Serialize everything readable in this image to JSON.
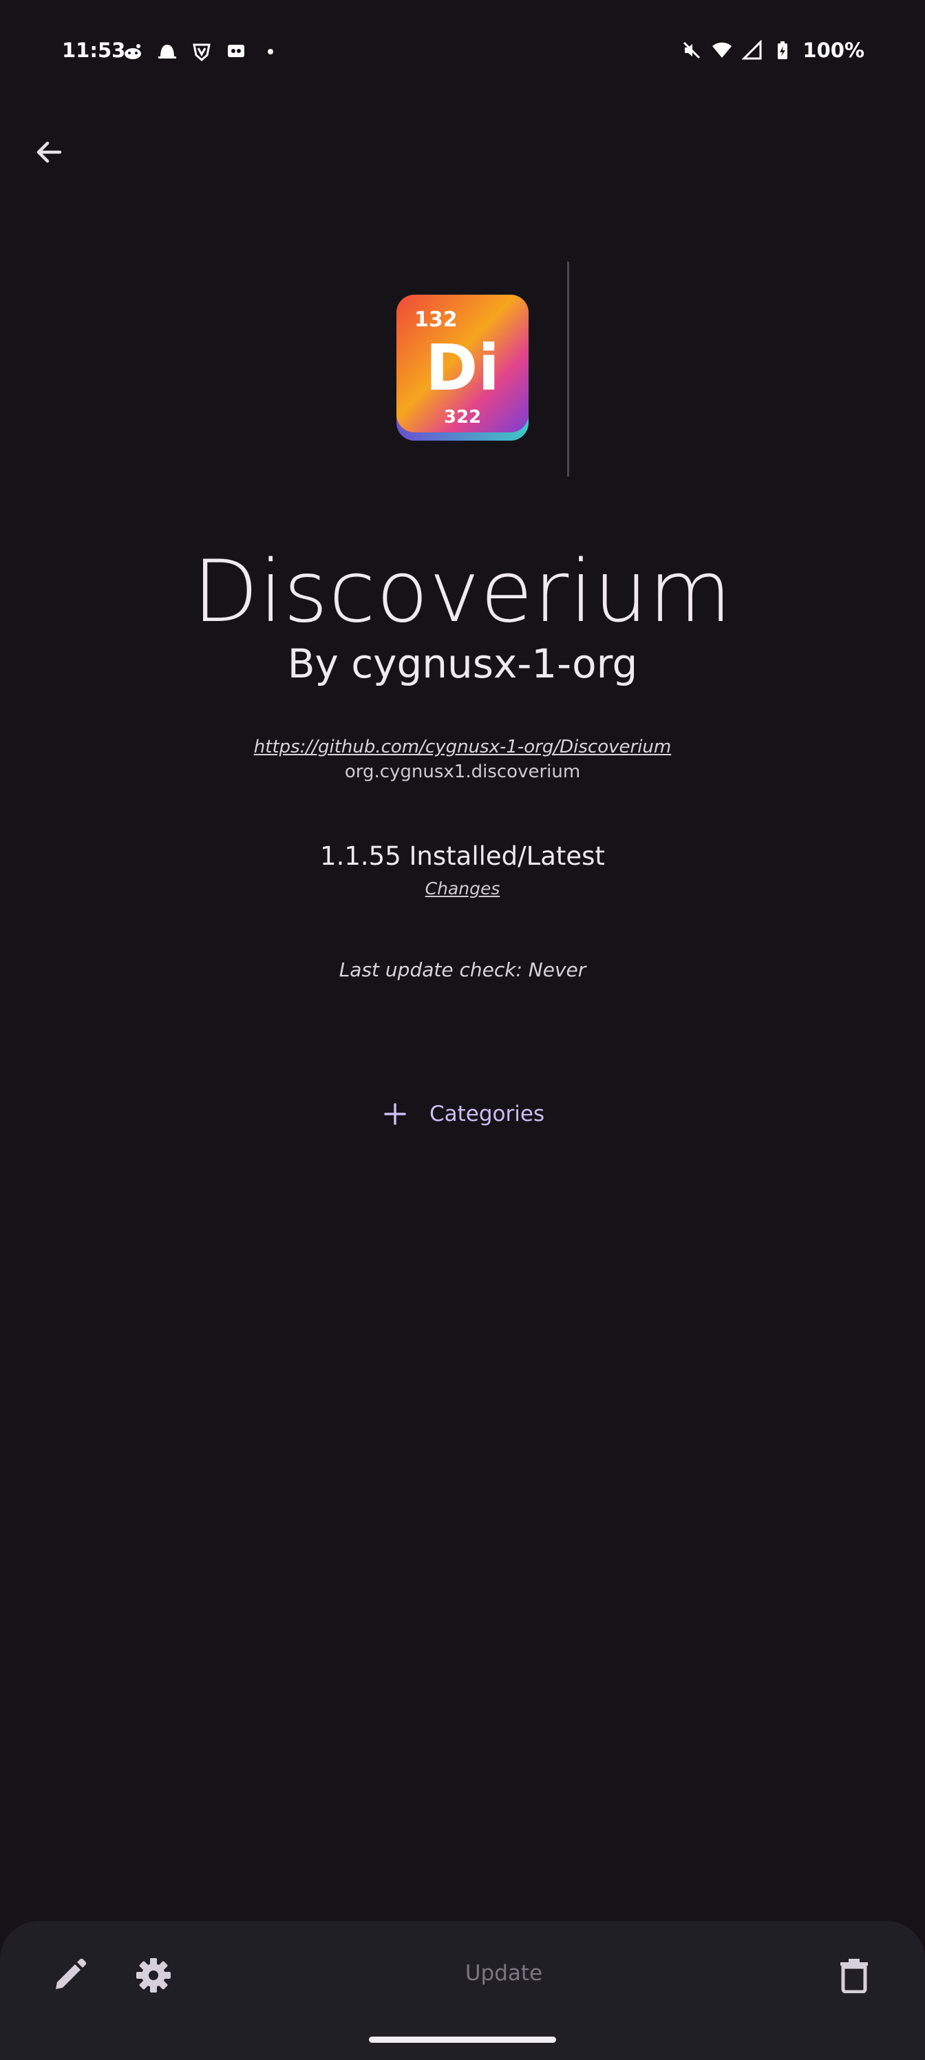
{
  "status_bar": {
    "time": "11:53",
    "battery": "100%",
    "left_icons": [
      "reddit-alien-icon",
      "ghost-icon",
      "shield-v-icon",
      "voicemail-icon",
      "dot-icon"
    ],
    "right_icons": [
      "mute-icon",
      "wifi-icon",
      "signal-icon",
      "battery-charging-icon"
    ]
  },
  "nav": {
    "back_icon": "arrow-back-icon"
  },
  "app": {
    "icon": {
      "top_number": "132",
      "symbol": "Di",
      "bottom_number": "322"
    },
    "name": "Discoverium",
    "author": "By cygnusx-1-org",
    "url": "https://github.com/cygnusx-1-org/Discoverium",
    "package": "org.cygnusx1.discoverium",
    "version": "1.1.55 Installed/Latest",
    "changes_label": "Changes",
    "last_check": "Last update check: Never"
  },
  "categories": {
    "label": "Categories",
    "icon": "plus-icon"
  },
  "bottom_bar": {
    "edit_icon": "pencil-icon",
    "settings_icon": "gear-icon",
    "update_label": "Update",
    "delete_icon": "trash-icon"
  },
  "colors": {
    "background": "#151318",
    "accent": "#cdbdf2",
    "bottom_bar": "#211f26"
  }
}
